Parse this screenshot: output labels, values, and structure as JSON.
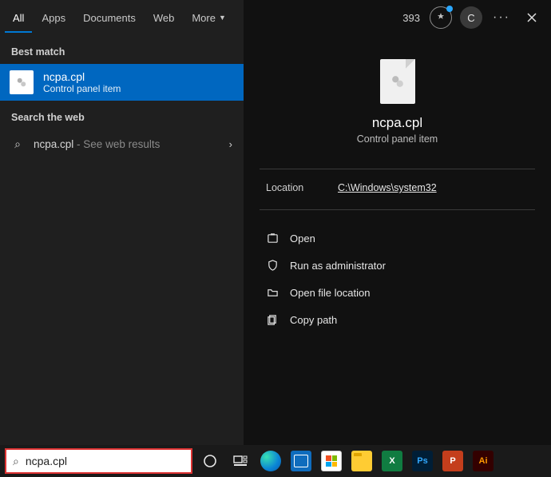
{
  "tabs": {
    "all": "All",
    "apps": "Apps",
    "documents": "Documents",
    "web": "Web",
    "more": "More"
  },
  "header": {
    "points": "393",
    "avatar_initial": "C"
  },
  "sections": {
    "best_match": "Best match",
    "search_web": "Search the web"
  },
  "best": {
    "title": "ncpa.cpl",
    "subtitle": "Control panel item"
  },
  "web_result": {
    "term": "ncpa.cpl",
    "suffix": " - See web results"
  },
  "preview": {
    "title": "ncpa.cpl",
    "subtitle": "Control panel item"
  },
  "meta": {
    "location_label": "Location",
    "location_value": "C:\\Windows\\system32"
  },
  "actions": {
    "open": "Open",
    "admin": "Run as administrator",
    "openloc": "Open file location",
    "copy": "Copy path"
  },
  "search": {
    "value": "ncpa.cpl"
  },
  "tb_apps": {
    "xl": "X",
    "ps": "Ps",
    "pp": "P",
    "ai": "Ai"
  }
}
